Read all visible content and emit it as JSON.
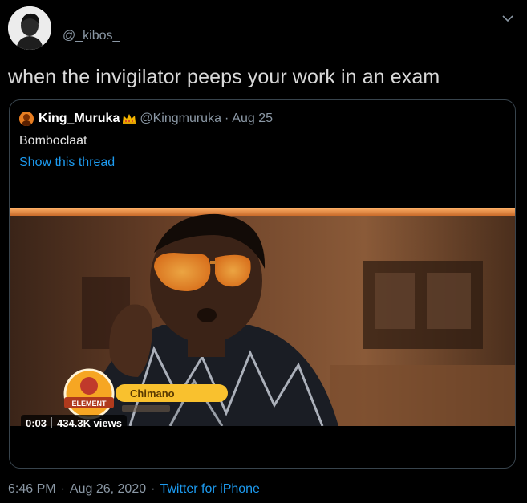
{
  "tweet": {
    "handle": "@_kibos_",
    "text": "when the invigilator peeps your work in an exam",
    "time": "6:46 PM",
    "date": "Aug 26, 2020",
    "source": "Twitter for iPhone"
  },
  "quoted": {
    "name": "King_Muruka",
    "handle": "@Kingmuruka",
    "date": "Aug 25",
    "text": "Bomboclaat",
    "show_thread": "Show this thread"
  },
  "video": {
    "time": "0:03",
    "views": "434.3K views",
    "lower_third_name": "Chimano",
    "logo_text": "ELEMENT"
  },
  "colors": {
    "background": "#000000",
    "muted": "#8b98a5",
    "link": "#1d9bf0",
    "border": "#38444d"
  },
  "icons": {
    "chevron": "chevron-down-icon",
    "crown": "crown-icon"
  }
}
